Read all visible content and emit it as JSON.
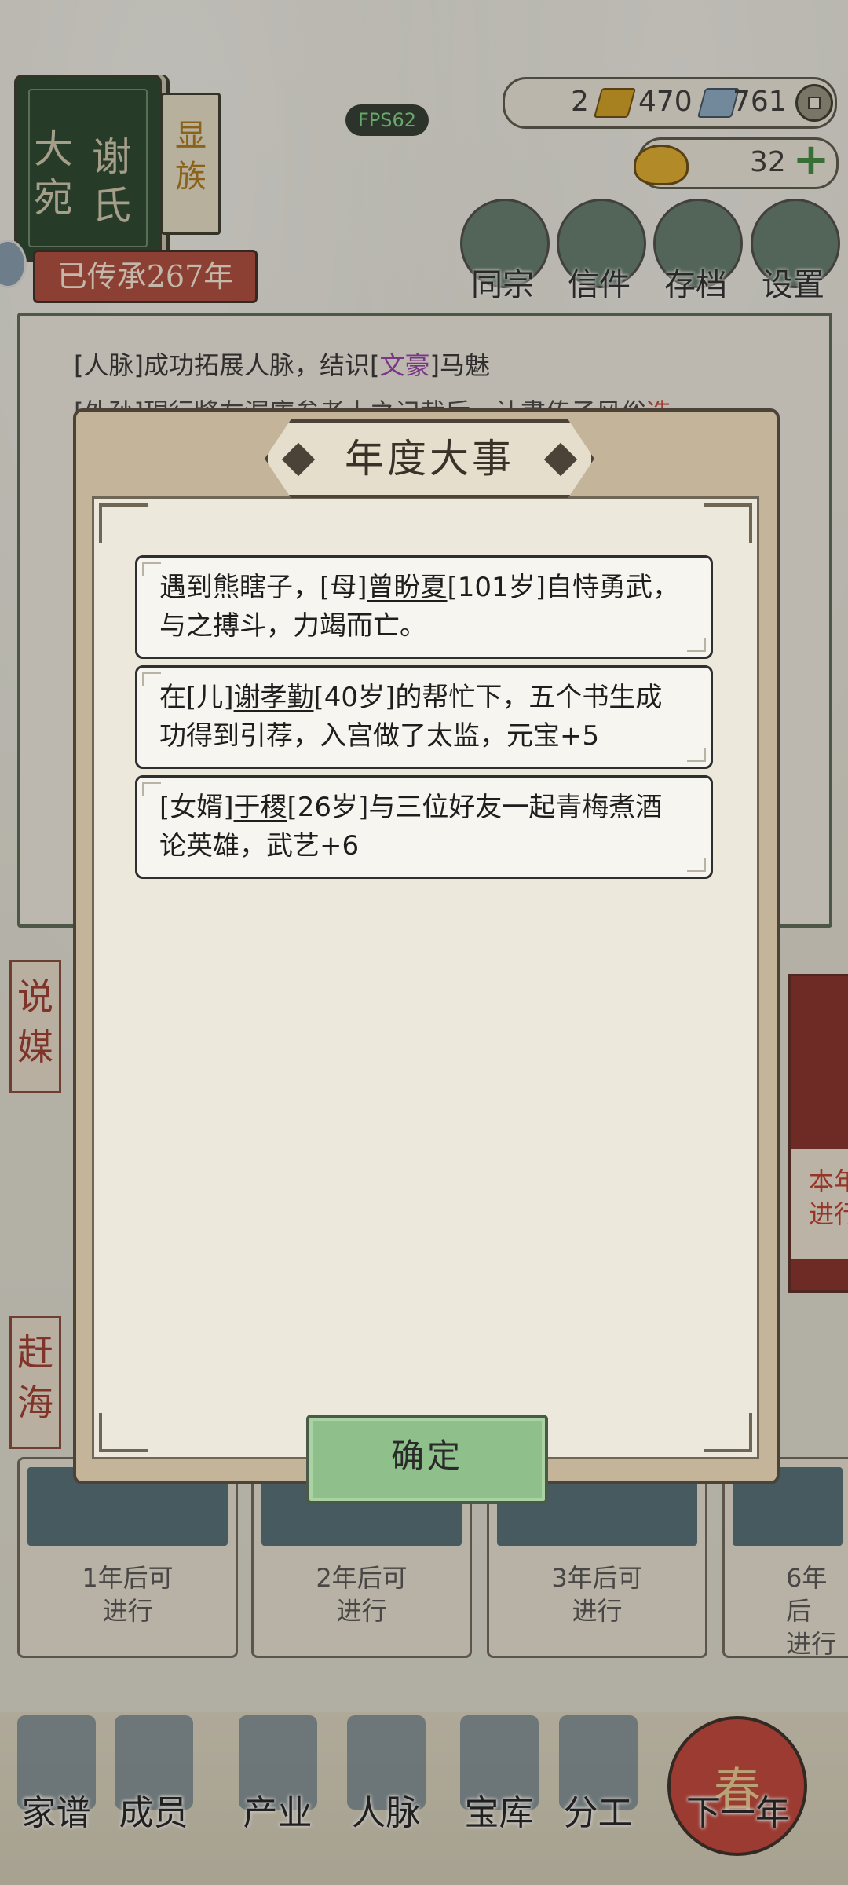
{
  "header": {
    "family_book": {
      "col1": "大宛",
      "col2": "谢氏",
      "rank": "显族"
    },
    "inherit_text": "已传承267年",
    "fps": "FPS62"
  },
  "resources": {
    "gold": "2",
    "silver": "470",
    "coins": "761",
    "yuanbao": "32"
  },
  "top_buttons": [
    "同宗",
    "信件",
    "存档",
    "设置"
  ],
  "log": {
    "line1_prefix": "[人脉]成功拓展人脉，结识[",
    "line1_highlight": "文豪",
    "line1_suffix": "]马魅",
    "line2_partial": "[外孙]現行將左渥廈参者士之记裁后，让書传子风俗",
    "line2_red": "选"
  },
  "side_tags": [
    "说媒",
    "赶海"
  ],
  "right_card_text": [
    "本年",
    "进行"
  ],
  "bottom_cards": [
    {
      "line1": "1年后可",
      "line2": "进行"
    },
    {
      "line1": "2年后可",
      "line2": "进行"
    },
    {
      "line1": "3年后可",
      "line2": "进行"
    },
    {
      "line1": "6年后",
      "line2": "进行"
    }
  ],
  "bottom_nav": [
    "家谱",
    "成员",
    "产业",
    "人脉",
    "宝库",
    "分工",
    "下一年"
  ],
  "lantern_char": "春",
  "modal": {
    "title": "年度大事",
    "events": [
      {
        "pre": "遇到熊瞎子，[母]",
        "name": "曾盼夏",
        "post": "[101岁]自恃勇武，与之搏斗，力竭而亡。"
      },
      {
        "pre": "在[儿]",
        "name": "谢孝勤",
        "post": "[40岁]的帮忙下，五个书生成功得到引荐，入宫做了太监，元宝+5"
      },
      {
        "pre": "[女婿]",
        "name": "于稷",
        "post": "[26岁]与三位好友一起青梅煮酒论英雄，武艺+6"
      }
    ],
    "confirm_label": "确定"
  }
}
